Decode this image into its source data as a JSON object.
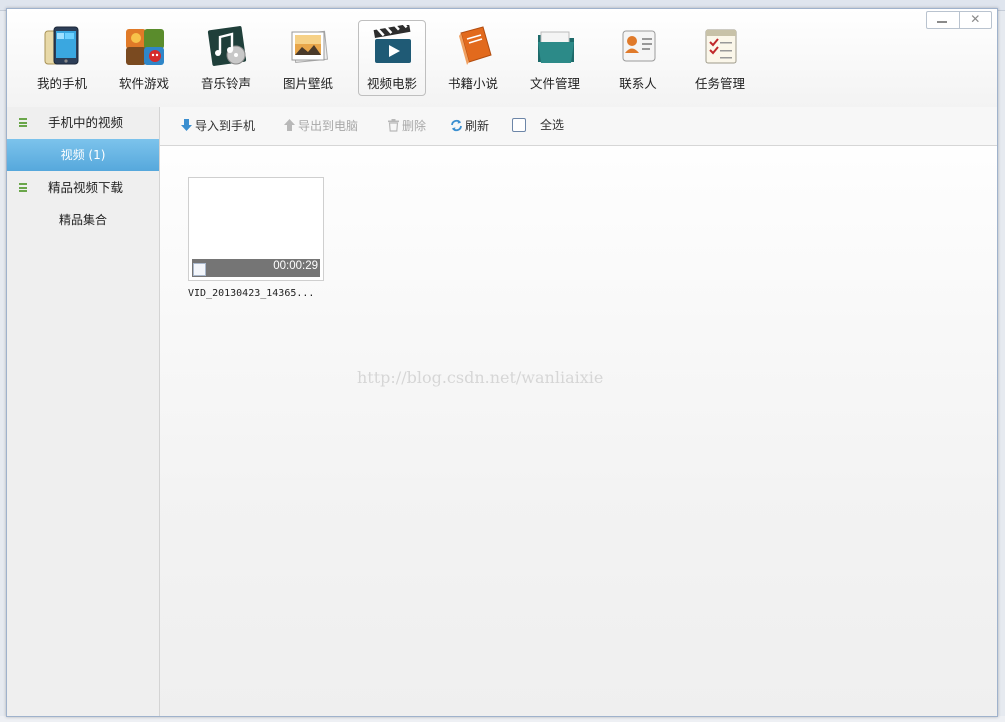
{
  "window": {
    "minimize": "—",
    "close": "✕"
  },
  "nav": {
    "items": [
      {
        "label": "我的手机",
        "icon": "phone-icon"
      },
      {
        "label": "软件游戏",
        "icon": "apps-games-icon"
      },
      {
        "label": "音乐铃声",
        "icon": "music-note-icon"
      },
      {
        "label": "图片壁纸",
        "icon": "photo-icon"
      },
      {
        "label": "视频电影",
        "icon": "clapperboard-icon",
        "active": true
      },
      {
        "label": "书籍小说",
        "icon": "book-icon"
      },
      {
        "label": "文件管理",
        "icon": "folder-icon"
      },
      {
        "label": "联系人",
        "icon": "contact-card-icon"
      },
      {
        "label": "任务管理",
        "icon": "checklist-icon"
      }
    ]
  },
  "sidebar": {
    "group1_title": "手机中的视频",
    "item_video": "视频 (1)",
    "group2_title": "精品视频下载",
    "item_collection": "精品集合"
  },
  "toolbar": {
    "import_label": "导入到手机",
    "export_label": "导出到电脑",
    "delete_label": "删除",
    "refresh_label": "刷新",
    "select_all_label": "全选"
  },
  "content": {
    "video": {
      "duration": "00:00:29",
      "filename": "VID_20130423_14365..."
    },
    "watermark": "http://blog.csdn.net/wanliaixie"
  },
  "colors": {
    "accent": "#56a8dc",
    "sidebar_bg": "#efefef",
    "bullet": "#6aa64a",
    "import_arrow": "#3b8fd0"
  }
}
